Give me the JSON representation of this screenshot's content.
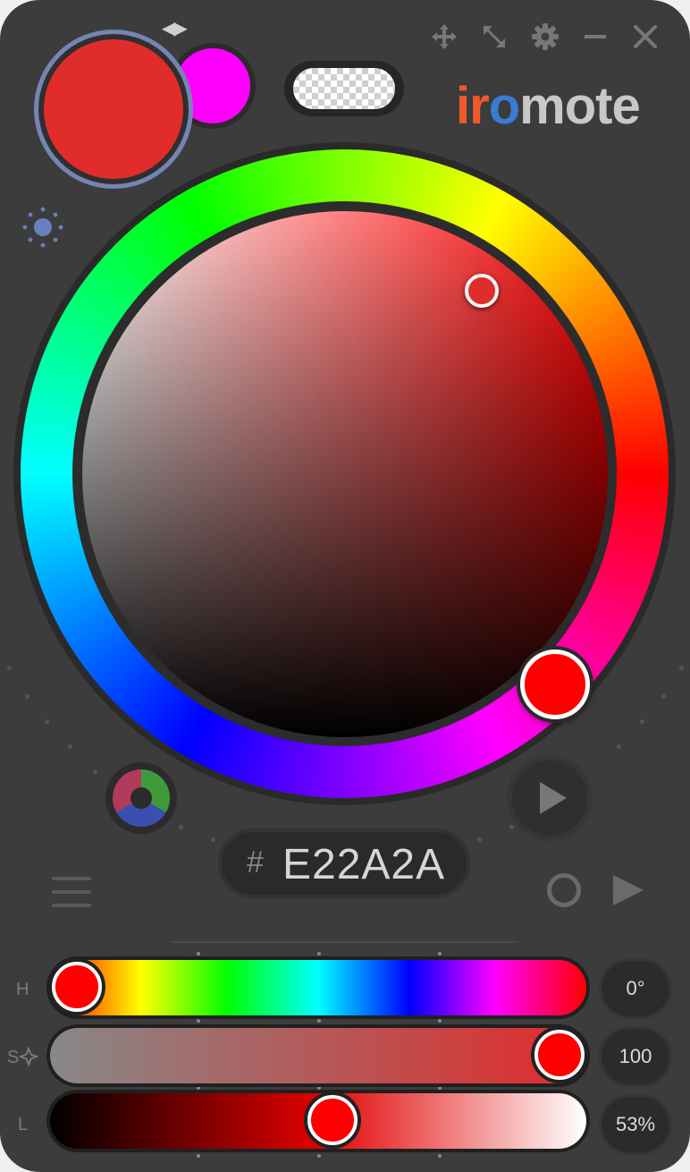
{
  "app": {
    "logo": {
      "part1": "ir",
      "part2": "o",
      "part3": "mote"
    }
  },
  "colors": {
    "primary": "#E22A2A",
    "secondary": "#FF00FF",
    "accent_ring": "#7485B5"
  },
  "window_controls": [
    "move-icon",
    "resize-icon",
    "gear-icon",
    "minimize-icon",
    "close-icon"
  ],
  "hex": {
    "hash": "#",
    "value": "E22A2A"
  },
  "sliders": [
    {
      "label": "H",
      "value_text": "0°",
      "level": 0.0
    },
    {
      "label": "S",
      "value_text": "100",
      "level": 1.0
    },
    {
      "label": "L",
      "value_text": "53%",
      "level": 0.53
    }
  ]
}
